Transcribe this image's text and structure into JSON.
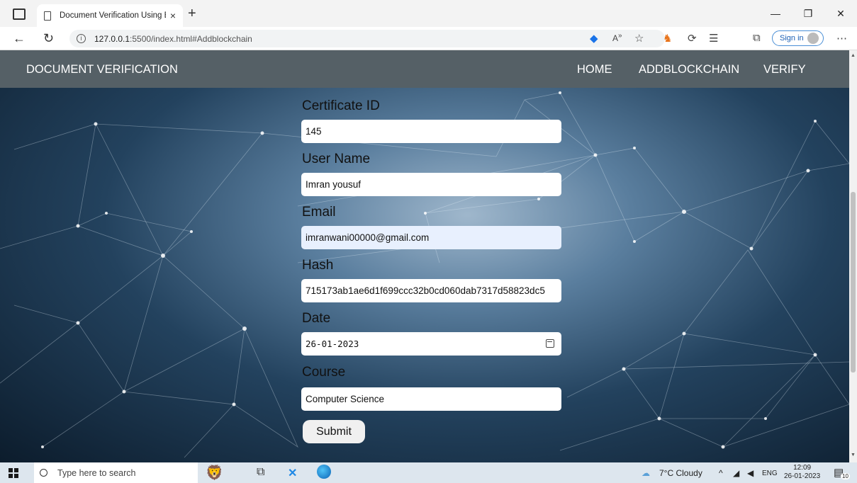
{
  "browser": {
    "tab_title": "Document Verification Using Blo",
    "url_host": "127.0.0.1",
    "url_rest": ":5500/index.html#Addblockchain",
    "signin_label": "Sign in",
    "new_tab": "+",
    "close_tab": "×"
  },
  "site": {
    "brand": "DOCUMENT VERIFICATION",
    "nav": {
      "home": "HOME",
      "add": "ADDBLOCKCHAIN",
      "verify": "VERIFY"
    }
  },
  "form": {
    "certificate_id_label": "Certificate ID",
    "certificate_id_value": "145",
    "user_name_label": "User Name",
    "user_name_value": "Imran yousuf",
    "email_label": "Email",
    "email_value": "imranwani00000@gmail.com",
    "hash_label": "Hash",
    "hash_value": "715173ab1ae6d1f699ccc32b0cd060dab7317d58823dc5",
    "date_label": "Date",
    "date_value": "26-01-2023",
    "course_label": "Course",
    "course_value": "Computer Science",
    "submit_label": "Submit"
  },
  "taskbar": {
    "search_placeholder": "Type here to search",
    "weather": "7°C  Cloudy",
    "lang": "ENG",
    "time": "12:09",
    "date": "26-01-2023",
    "notifications": "10"
  }
}
